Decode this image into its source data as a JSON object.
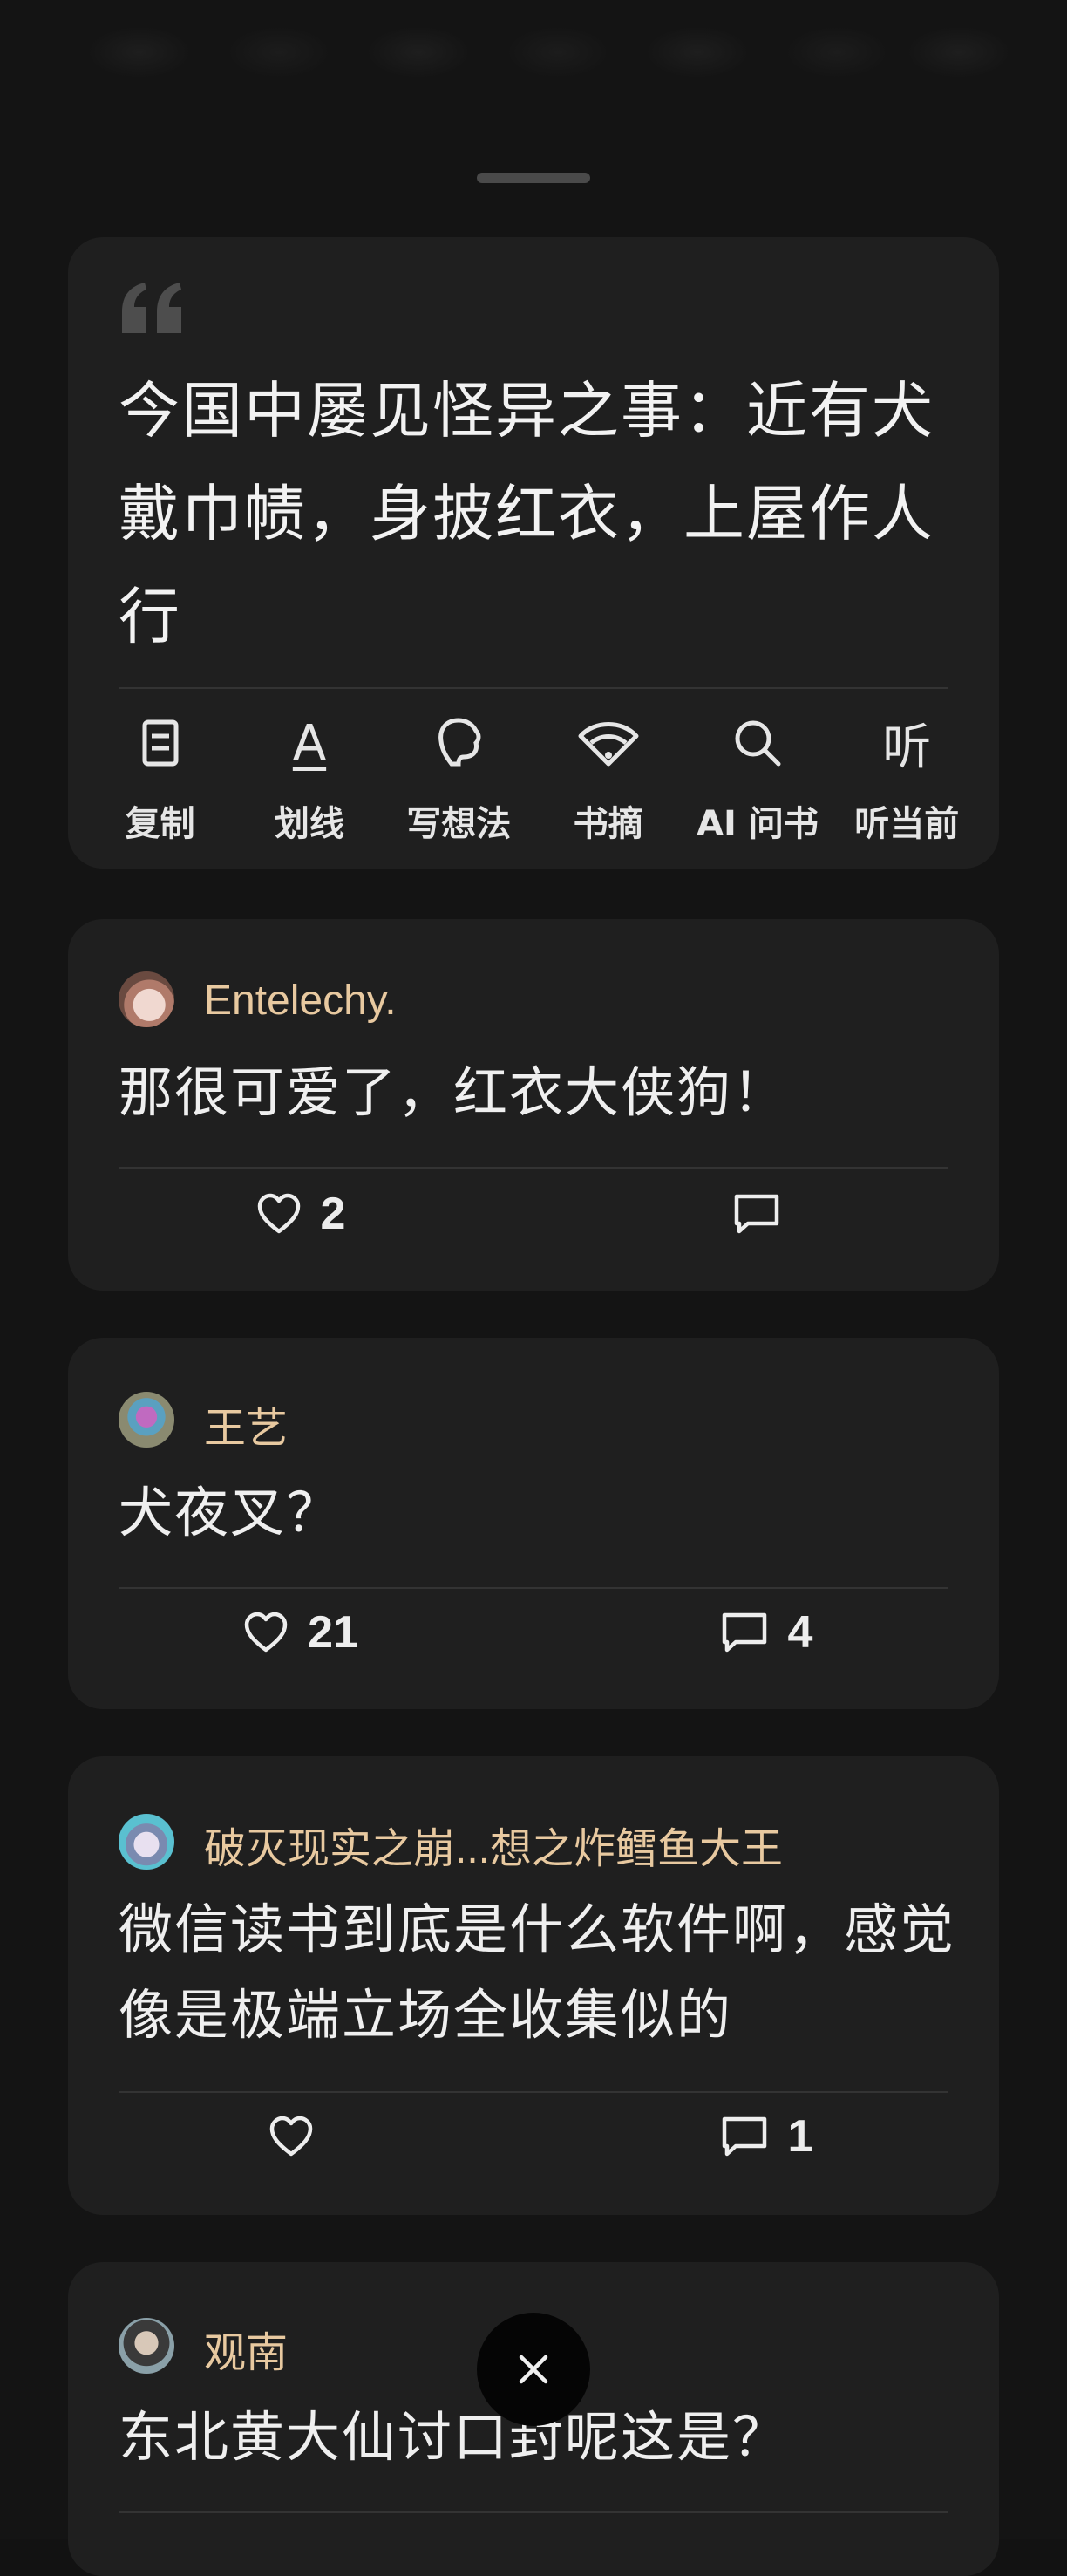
{
  "quote": {
    "text": "今国中屡见怪异之事：近有犬戴巾帻，身披红衣，上屋作人行"
  },
  "actions": [
    {
      "label": "复制",
      "icon": "copy-icon"
    },
    {
      "label": "划线",
      "icon": "underline-icon",
      "glyph": "A"
    },
    {
      "label": "写想法",
      "icon": "thought-bubble-icon"
    },
    {
      "label": "书摘",
      "icon": "fan-icon"
    },
    {
      "label": "AI 问书",
      "icon": "search-icon"
    },
    {
      "label": "听当前",
      "icon": "listen-icon",
      "glyph": "听"
    }
  ],
  "comments": [
    {
      "user": "Entelechy.",
      "text": "那很可爱了，红衣大侠狗！",
      "likes": "2",
      "replies": ""
    },
    {
      "user": "王艺",
      "text": "犬夜叉？",
      "likes": "21",
      "replies": "4"
    },
    {
      "user": "破灭现实之崩...想之炸鳕鱼大王",
      "text": "微信读书到底是什么软件啊，感觉像是极端立场全收集似的",
      "likes": "",
      "replies": "1"
    },
    {
      "user": "观南",
      "text": "东北黄大仙讨口封呢这是？",
      "likes": "",
      "replies": ""
    }
  ],
  "colors": {
    "background": "#121212",
    "card": "#1f1f1f",
    "username": "#e8c9a0"
  }
}
